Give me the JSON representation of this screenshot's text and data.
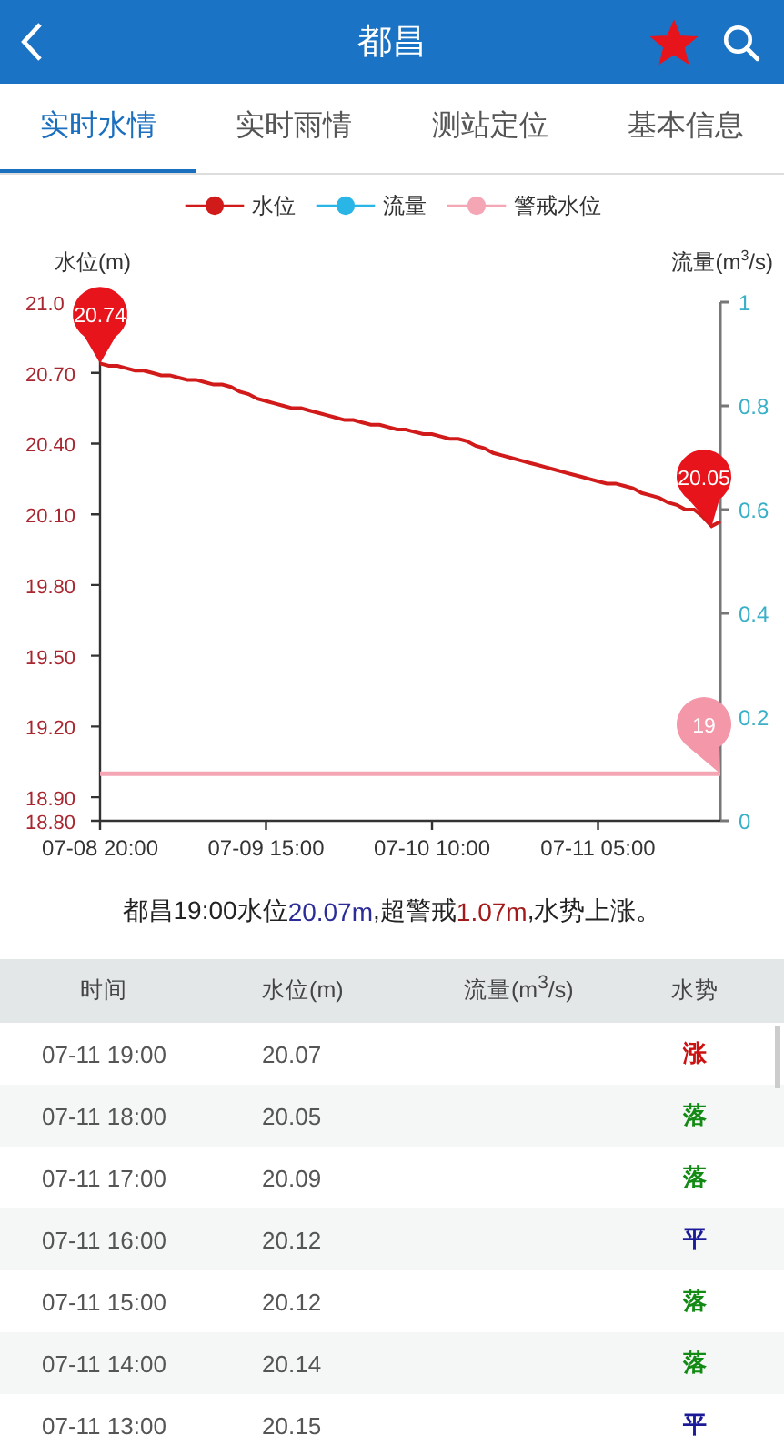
{
  "header": {
    "title": "都昌",
    "favorite": true
  },
  "tabs": [
    {
      "label": "实时水情",
      "selected": true
    },
    {
      "label": "实时雨情",
      "selected": false
    },
    {
      "label": "测站定位",
      "selected": false
    },
    {
      "label": "基本信息",
      "selected": false
    }
  ],
  "chart": {
    "chart_data": {
      "type": "line",
      "ylabel": "水位(m)",
      "y2label": "流量(m$^{3}$/s)",
      "y2lim": [
        0,
        1
      ],
      "categories": [
        "07-08 20:00",
        null,
        null,
        null,
        null,
        null,
        null,
        null,
        null,
        null,
        null,
        null,
        null,
        null,
        null,
        null,
        null,
        null,
        null,
        "07-09 15:00",
        null,
        null,
        null,
        null,
        null,
        null,
        null,
        null,
        null,
        null,
        null,
        null,
        null,
        null,
        null,
        null,
        null,
        null,
        "07-10 10:00",
        null,
        null,
        null,
        null,
        null,
        null,
        null,
        null,
        null,
        null,
        null,
        null,
        null,
        null,
        null,
        null,
        null,
        null,
        "07-11 05:00",
        null,
        null,
        null,
        null,
        null,
        null,
        null,
        null,
        null,
        null,
        null,
        null,
        null,
        null
      ],
      "ylim": [
        18.8,
        21.0
      ],
      "yticks": [
        {
          "value": 18.8,
          "label": "18.80"
        },
        {
          "value": 18.9,
          "label": "18.90"
        },
        {
          "value": 19.2,
          "label": "19.20"
        },
        {
          "value": 19.5,
          "label": "19.50"
        },
        {
          "value": 19.8,
          "label": "19.80"
        },
        {
          "value": 20.1,
          "label": "20.10"
        },
        {
          "value": 20.4,
          "label": "20.40"
        },
        {
          "value": 20.7,
          "label": "20.70"
        },
        {
          "value": 21.0,
          "label": "21.0"
        }
      ],
      "y2ticks": [
        {
          "value": 0,
          "label": "0"
        },
        {
          "value": 0.2,
          "label": "0.2"
        },
        {
          "value": 0.4,
          "label": "0.4"
        },
        {
          "value": 0.6,
          "label": "0.6"
        },
        {
          "value": 0.8,
          "label": "0.8"
        },
        {
          "value": 1,
          "label": "1"
        }
      ],
      "series": [
        {
          "name": "水位",
          "color": "#d11a1a",
          "values": [
            20.74,
            20.73,
            20.73,
            20.72,
            20.71,
            20.71,
            20.7,
            20.69,
            20.69,
            20.68,
            20.67,
            20.67,
            20.66,
            20.65,
            20.65,
            20.64,
            20.62,
            20.61,
            20.59,
            20.58,
            20.57,
            20.56,
            20.55,
            20.55,
            20.54,
            20.53,
            20.52,
            20.51,
            20.5,
            20.5,
            20.49,
            20.48,
            20.48,
            20.47,
            20.46,
            20.46,
            20.45,
            20.44,
            20.44,
            20.43,
            20.42,
            20.42,
            20.41,
            20.39,
            20.38,
            20.36,
            20.35,
            20.34,
            20.33,
            20.32,
            20.31,
            20.3,
            20.29,
            20.28,
            20.27,
            20.26,
            20.25,
            20.24,
            20.23,
            20.23,
            20.22,
            20.21,
            20.19,
            20.18,
            20.17,
            20.15,
            20.14,
            20.12,
            20.12,
            20.09,
            20.05,
            20.07
          ]
        },
        {
          "name": "流量",
          "color": "#29b6e6",
          "values": [
            null,
            null,
            null,
            null,
            null,
            null,
            null,
            null,
            null,
            null,
            null,
            null,
            null,
            null,
            null,
            null,
            null,
            null,
            null,
            null,
            null,
            null,
            null,
            null,
            null,
            null,
            null,
            null,
            null,
            null,
            null,
            null,
            null,
            null,
            null,
            null,
            null,
            null,
            null,
            null,
            null,
            null,
            null,
            null,
            null,
            null,
            null,
            null,
            null,
            null,
            null,
            null,
            null,
            null,
            null,
            null,
            null,
            null,
            null,
            null,
            null,
            null,
            null,
            null,
            null,
            null,
            null,
            null,
            null,
            null,
            null,
            null
          ]
        },
        {
          "name": "警戒水位",
          "color": "#f4a6b5",
          "values": [
            19,
            19,
            19,
            19,
            19,
            19,
            19,
            19,
            19,
            19,
            19,
            19,
            19,
            19,
            19,
            19,
            19,
            19,
            19,
            19,
            19,
            19,
            19,
            19,
            19,
            19,
            19,
            19,
            19,
            19,
            19,
            19,
            19,
            19,
            19,
            19,
            19,
            19,
            19,
            19,
            19,
            19,
            19,
            19,
            19,
            19,
            19,
            19,
            19,
            19,
            19,
            19,
            19,
            19,
            19,
            19,
            19,
            19,
            19,
            19,
            19,
            19,
            19,
            19,
            19,
            19,
            19,
            19,
            19,
            19,
            19,
            19
          ]
        }
      ],
      "annotations": [
        {
          "y": 20.74,
          "text": "20.74"
        },
        {
          "y": 20.05,
          "text": "20.05"
        },
        {
          "y": 19.0,
          "text": "19"
        }
      ]
    }
  },
  "summary": [
    {
      "kind": "plain",
      "text": "都昌19:00水位"
    },
    {
      "kind": "level",
      "text": "20.07m"
    },
    {
      "kind": "plain",
      "text": ",超警戒"
    },
    {
      "kind": "excess",
      "text": "1.07m"
    },
    {
      "kind": "plain",
      "text": ",水势上涨。"
    }
  ],
  "table": {
    "columns": [
      "时间",
      "水位(m)",
      "流量(m$^{3}$/s)",
      "水势"
    ],
    "rows": [
      {
        "time": "07-11 19:00",
        "level": "20.07",
        "trend": "涨",
        "color": "#cc1111"
      },
      {
        "time": "07-11 18:00",
        "level": "20.05",
        "trend": "落",
        "color": "#138a13"
      },
      {
        "time": "07-11 17:00",
        "level": "20.09",
        "trend": "落",
        "color": "#138a13"
      },
      {
        "time": "07-11 16:00",
        "level": "20.12",
        "trend": "平",
        "color": "#1a1a99"
      },
      {
        "time": "07-11 15:00",
        "level": "20.12",
        "trend": "落",
        "color": "#138a13"
      },
      {
        "time": "07-11 14:00",
        "level": "20.14",
        "trend": "落",
        "color": "#138a13"
      },
      {
        "time": "07-11 13:00",
        "level": "20.15",
        "trend": "平",
        "color": "#1a1a99"
      }
    ]
  }
}
